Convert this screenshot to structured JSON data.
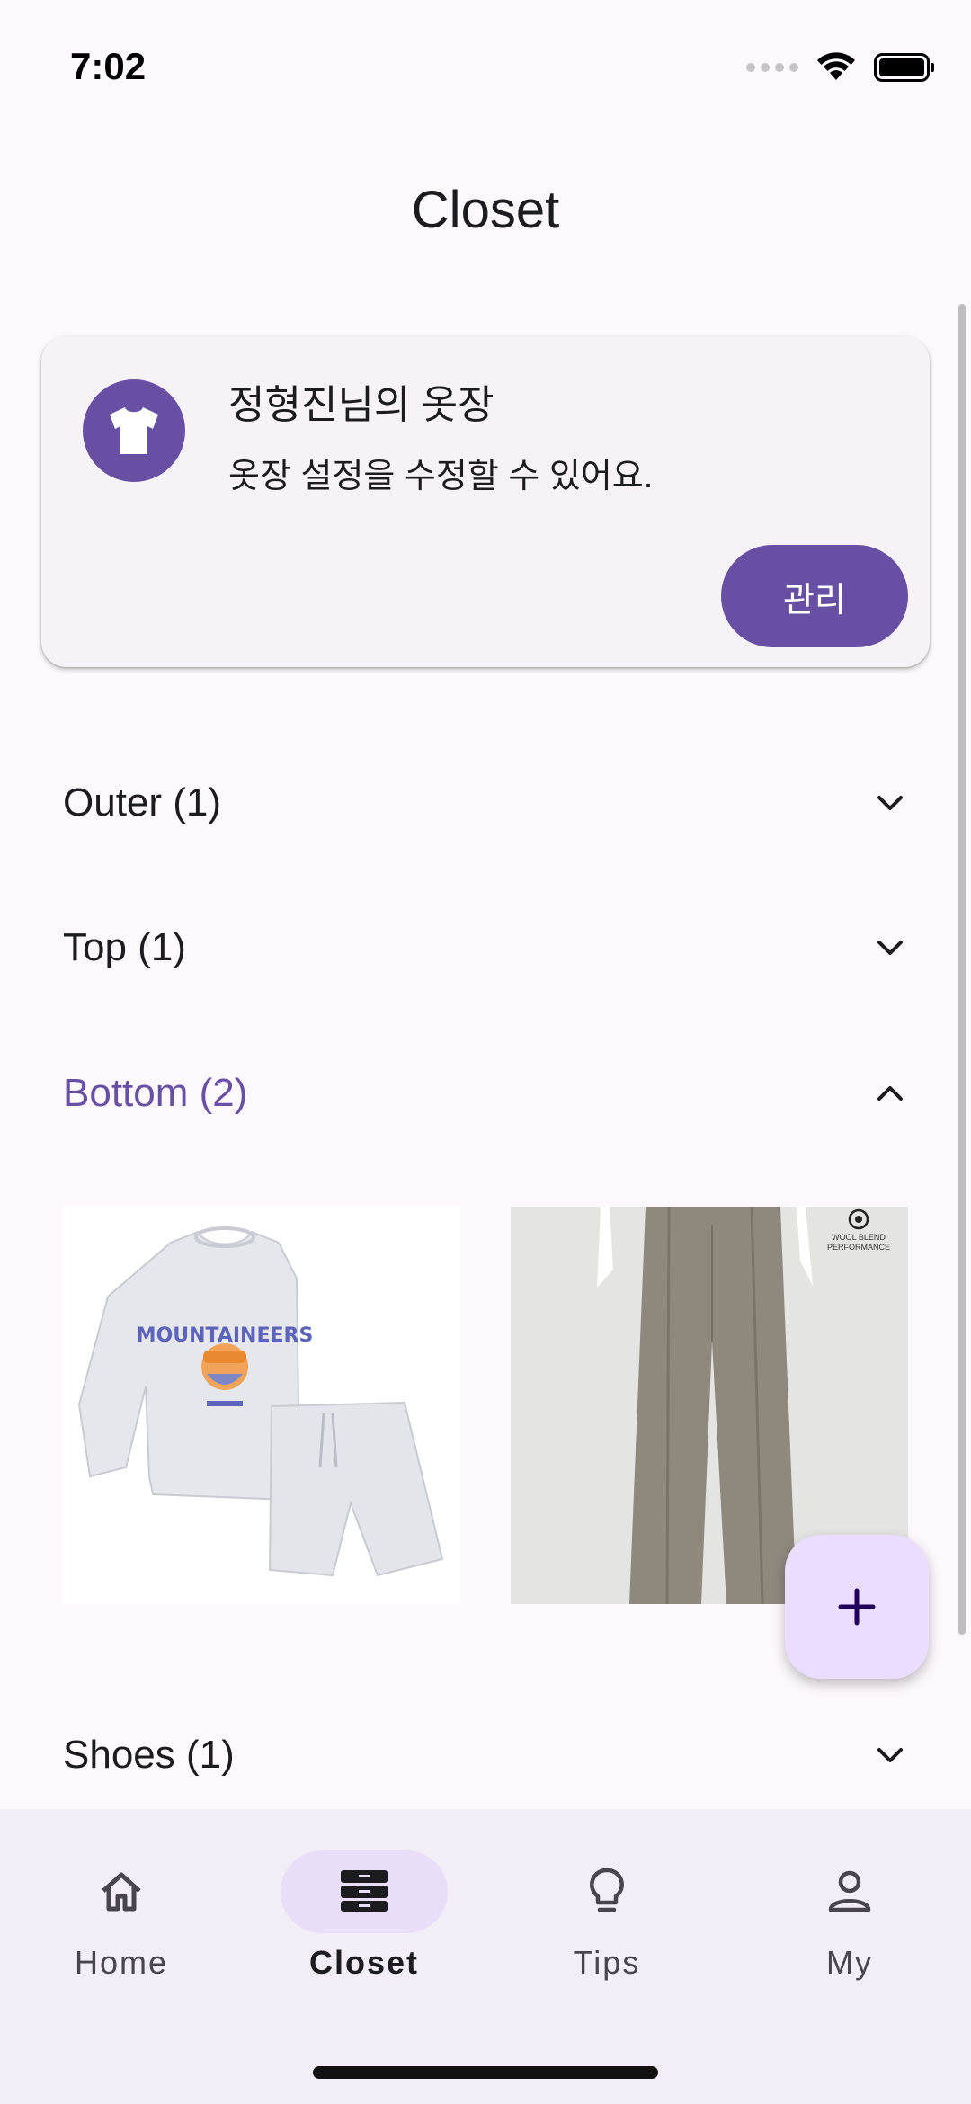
{
  "status_bar": {
    "time": "7:02"
  },
  "header": {
    "title": "Closet"
  },
  "closet_card": {
    "title": "정형진님의 옷장",
    "subtitle": "옷장 설정을 수정할 수 있어요.",
    "manage_label": "관리",
    "icon": "tshirt-icon"
  },
  "categories": [
    {
      "label": "Outer (1)",
      "expanded": false
    },
    {
      "label": "Top (1)",
      "expanded": false
    },
    {
      "label": "Bottom (2)",
      "expanded": true
    },
    {
      "label": "Shoes (1)",
      "expanded": false
    }
  ],
  "bottom_items": [
    {
      "name": "sweatshirt-shorts-set",
      "print_text": "MOUNTAINEERS"
    },
    {
      "name": "wide-trousers",
      "badge_text": "WOOL BLEND PERFORMANCE"
    }
  ],
  "fab": {
    "icon": "plus-icon"
  },
  "nav": {
    "items": [
      {
        "label": "Home",
        "icon": "home-icon"
      },
      {
        "label": "Closet",
        "icon": "closet-icon",
        "active": true
      },
      {
        "label": "Tips",
        "icon": "lightbulb-icon"
      },
      {
        "label": "My",
        "icon": "person-icon"
      }
    ]
  },
  "colors": {
    "primary": "#6750a4",
    "fab_bg": "#eaddff",
    "nav_bg": "#f2edf6",
    "nav_pill": "#e8def8",
    "background": "#fdf8fc"
  }
}
